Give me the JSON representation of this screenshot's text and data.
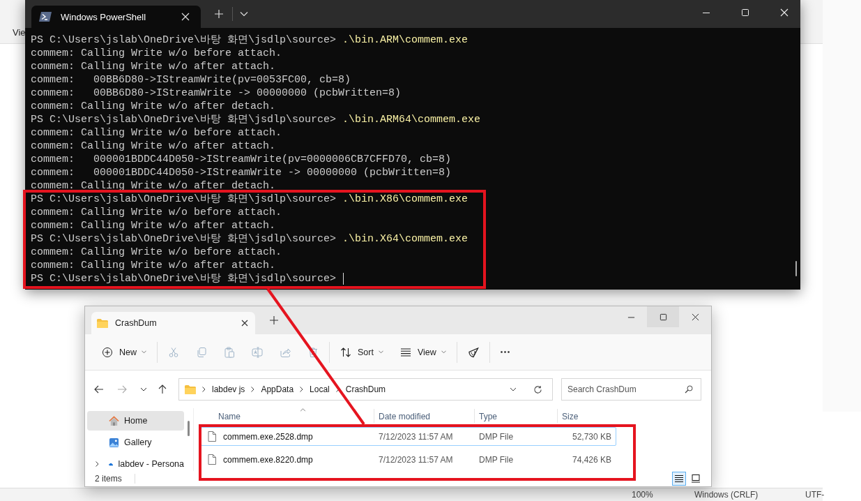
{
  "background_app": {
    "menu_label": "Vie",
    "status_items": [
      "100%",
      "Windows (CRLF)",
      "UTF-"
    ]
  },
  "terminal": {
    "tab_title": "Windows PowerShell",
    "lines": [
      {
        "kind": "prompt",
        "prompt": "PS C:\\Users\\jslab\\OneDrive\\바탕 화면\\jsdlp\\source>",
        "command": ".\\bin.ARM\\commem.exe"
      },
      {
        "kind": "output",
        "text": "commem: Calling Write w/o before attach."
      },
      {
        "kind": "output",
        "text": "commem: Calling Write w/o after attach."
      },
      {
        "kind": "output",
        "text": "commem:   00BB6D80->IStreamWrite(pv=0053FC00, cb=8)"
      },
      {
        "kind": "output",
        "text": "commem:   00BB6D80->IStreamWrite -> 00000000 (pcbWritten=8)"
      },
      {
        "kind": "output",
        "text": "commem: Calling Write w/o after detach."
      },
      {
        "kind": "prompt",
        "prompt": "PS C:\\Users\\jslab\\OneDrive\\바탕 화면\\jsdlp\\source>",
        "command": ".\\bin.ARM64\\commem.exe"
      },
      {
        "kind": "output",
        "text": "commem: Calling Write w/o before attach."
      },
      {
        "kind": "output",
        "text": "commem: Calling Write w/o after attach."
      },
      {
        "kind": "output",
        "text": "commem:   000001BDDC44D050->IStreamWrite(pv=0000006CB7CFFD70, cb=8)"
      },
      {
        "kind": "output",
        "text": "commem:   000001BDDC44D050->IStreamWrite -> 00000000 (pcbWritten=8)"
      },
      {
        "kind": "output",
        "text": "commem: Calling Write w/o after detach."
      },
      {
        "kind": "prompt",
        "prompt": "PS C:\\Users\\jslab\\OneDrive\\바탕 화면\\jsdlp\\source>",
        "command": ".\\bin.X86\\commem.exe"
      },
      {
        "kind": "output",
        "text": "commem: Calling Write w/o before attach."
      },
      {
        "kind": "output",
        "text": "commem: Calling Write w/o after attach."
      },
      {
        "kind": "prompt",
        "prompt": "PS C:\\Users\\jslab\\OneDrive\\바탕 화면\\jsdlp\\source>",
        "command": ".\\bin.X64\\commem.exe"
      },
      {
        "kind": "output",
        "text": "commem: Calling Write w/o before attach."
      },
      {
        "kind": "output",
        "text": "commem: Calling Write w/o after attach."
      },
      {
        "kind": "prompt",
        "prompt": "PS C:\\Users\\jslab\\OneDrive\\바탕 화면\\jsdlp\\source>",
        "cursor": true
      }
    ]
  },
  "explorer": {
    "tab_title": "CrashDum",
    "toolbar": [
      {
        "kind": "new",
        "label": "New",
        "disabled": false
      },
      {
        "kind": "cut",
        "disabled": true
      },
      {
        "kind": "copy",
        "disabled": true
      },
      {
        "kind": "paste",
        "disabled": true
      },
      {
        "kind": "rename",
        "disabled": true
      },
      {
        "kind": "share",
        "disabled": true
      },
      {
        "kind": "delete",
        "disabled": true
      },
      {
        "kind": "sort",
        "label": "Sort",
        "disabled": false
      },
      {
        "kind": "view",
        "label": "View",
        "disabled": false
      },
      {
        "kind": "slice"
      },
      {
        "kind": "more"
      }
    ],
    "breadcrumb": [
      "labdev js",
      "AppData",
      "Local",
      "CrashDum"
    ],
    "search": {
      "placeholder": "Search CrashDum"
    },
    "nav": [
      {
        "kind": "home",
        "label": "Home",
        "selected": true
      },
      {
        "kind": "gallery",
        "label": "Gallery",
        "selected": false
      },
      {
        "kind": "cloud",
        "label": "labdev - Persona",
        "selected": false
      }
    ],
    "columns": [
      "Name",
      "Date modified",
      "Type",
      "Size"
    ],
    "files": [
      {
        "name": "commem.exe.2528.dmp",
        "date": "7/12/2023 11:57 AM",
        "type": "DMP File",
        "size": "52,730 KB",
        "selected": true
      },
      {
        "name": "commem.exe.8220.dmp",
        "date": "7/12/2023 11:57 AM",
        "type": "DMP File",
        "size": "74,426 KB",
        "selected": false
      }
    ],
    "status": "2 items",
    "view_modes": [
      {
        "kind": "details",
        "selected": true
      },
      {
        "kind": "tiles",
        "selected": false
      }
    ]
  }
}
